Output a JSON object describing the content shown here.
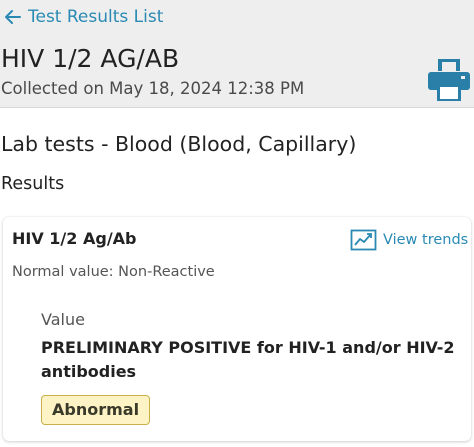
{
  "header": {
    "back_label": "Test Results List",
    "title": "HIV 1/2 AG/AB",
    "collected": "Collected on May 18, 2024 12:38 PM",
    "print_icon": "printer-icon"
  },
  "main": {
    "lab_heading": "Lab tests - Blood (Blood, Capillary)",
    "results_heading": "Results"
  },
  "result_card": {
    "test_name": "HIV 1/2 Ag/Ab",
    "view_trends_label": "View trends",
    "normal_value": "Normal value: Non-Reactive",
    "value_label": "Value",
    "value": "PRELIMINARY POSITIVE for HIV-1 and/or HIV-2 antibodies",
    "status_badge": "Abnormal"
  },
  "colors": {
    "accent": "#2a8ab3",
    "header_bg": "#eeeeee",
    "badge_bg": "#fdf3c4",
    "badge_border": "#c9b04a"
  }
}
